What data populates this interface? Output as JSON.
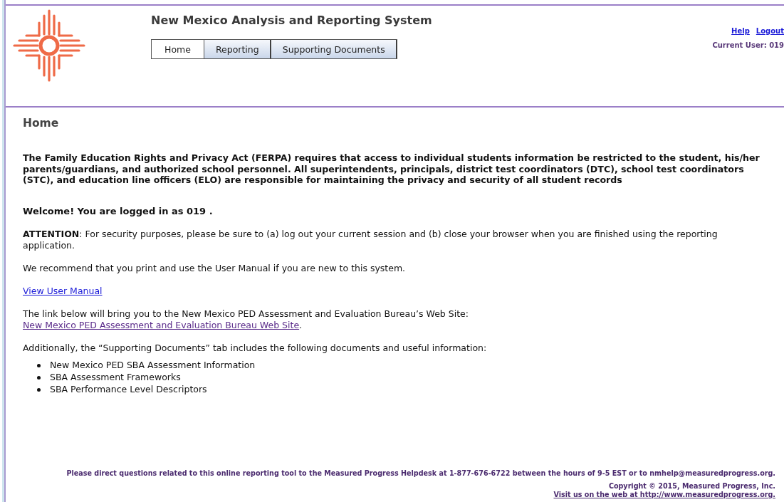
{
  "header": {
    "title": "New Mexico Analysis and Reporting System",
    "tabs": [
      {
        "label": "Home",
        "selected": true
      },
      {
        "label": "Reporting",
        "selected": false
      },
      {
        "label": "Supporting Documents",
        "selected": false
      }
    ],
    "links": [
      "Help",
      "Logout"
    ],
    "current_user": "Current User: 019"
  },
  "page_title": "Home",
  "ferpa_notice": "The Family Education Rights and Privacy Act (FERPA) requires that access to individual students information be restricted to the student, his/her parents/guardians, and authorized school personnel. All superintendents, principals, district test coordinators (DTC), school test coordinators (STC), and education line officers (ELO) are responsible for maintaining the privacy and security of all student records",
  "welcome": "Welcome! You are logged in as 019 .",
  "attention": "**ATTENTION**: For security purposes, please be sure to (a) log out your current session and (b) close your browser when you are finished using the reporting application.",
  "recommend": "We recommend that you print and use the User Manual if you are new to this system.",
  "manual_link": "View User Manual",
  "bureau_intro": "The link below will bring you to the New Mexico PED Assessment and Evaluation Bureau’s Web Site:",
  "bureau_link": "New Mexico PED Assessment and Evaluation Bureau Web Site",
  "bureau_period": ".",
  "documents_intro": "Additionally, the “Supporting Documents” tab includes the following documents and useful information:",
  "documents": [
    "New Mexico PED SBA Assessment Information",
    "SBA Assessment Frameworks",
    "SBA Performance Level Descriptors"
  ],
  "footer": {
    "contact": "Please direct questions related to this online reporting tool to the Measured Progress Helpdesk at 1-877-676-6722 between the hours of 9-5 EST or to nmhelp@measuredprogress.org.",
    "copyright": "Copyright © 2015, Measured Progress, Inc.",
    "web_link": "Visit us on the web at http://www.measuredprogress.org."
  }
}
